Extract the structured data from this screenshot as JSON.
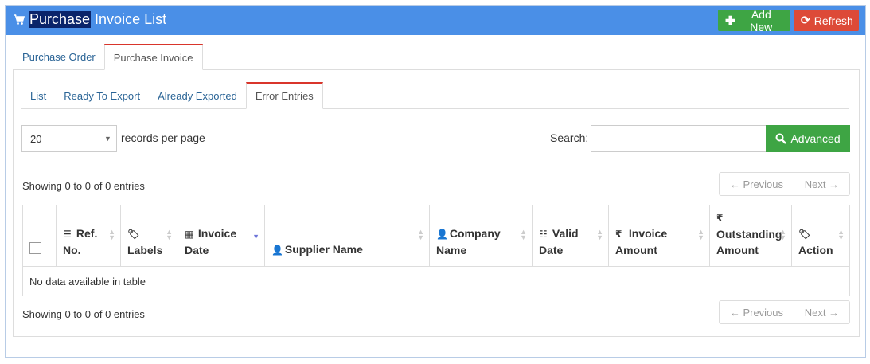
{
  "header": {
    "title": "Purchase Invoice List",
    "add_new_label": "Add New",
    "refresh_label": "Refresh",
    "colors": {
      "bar": "#4a8fe7",
      "add": "#3ea544",
      "refresh": "#dd4a38"
    }
  },
  "main_tabs": [
    {
      "label": "Purchase Order",
      "active": false
    },
    {
      "label": "Purchase Invoice",
      "active": true
    }
  ],
  "sub_tabs": [
    {
      "label": "List",
      "active": false
    },
    {
      "label": "Ready To Export",
      "active": false
    },
    {
      "label": "Already Exported",
      "active": false
    },
    {
      "label": "Error Entries",
      "active": true
    }
  ],
  "controls": {
    "page_size_value": "20",
    "records_per_page_label": "records per page",
    "search_label": "Search:",
    "search_value": "",
    "advanced_label": "Advanced"
  },
  "info": {
    "top": "Showing 0 to 0 of 0 entries",
    "bottom": "Showing 0 to 0 of 0 entries"
  },
  "pagination": {
    "previous": "← Previous",
    "next": "Next →"
  },
  "table": {
    "columns": [
      {
        "icon": "list-ol-icon",
        "line1": "Ref.",
        "line2": "No."
      },
      {
        "icon": "tags-icon",
        "line1": "",
        "line2": "Labels"
      },
      {
        "icon": "calendar-icon",
        "line1": "Invoice",
        "line2": "Date"
      },
      {
        "icon": "user-icon",
        "line1": "",
        "line2": "Supplier Name"
      },
      {
        "icon": "user-icon",
        "line1": "Company",
        "line2": "Name"
      },
      {
        "icon": "list-icon",
        "line1": "Valid",
        "line2": "Date"
      },
      {
        "icon": "rupee-icon",
        "line1": "Invoice",
        "line2": "Amount"
      },
      {
        "icon": "rupee-icon",
        "line1": "Outstanding",
        "line2": "Amount"
      },
      {
        "icon": "tags-icon",
        "line1": "",
        "line2": "Action"
      }
    ],
    "empty_message": "No data available in table"
  }
}
